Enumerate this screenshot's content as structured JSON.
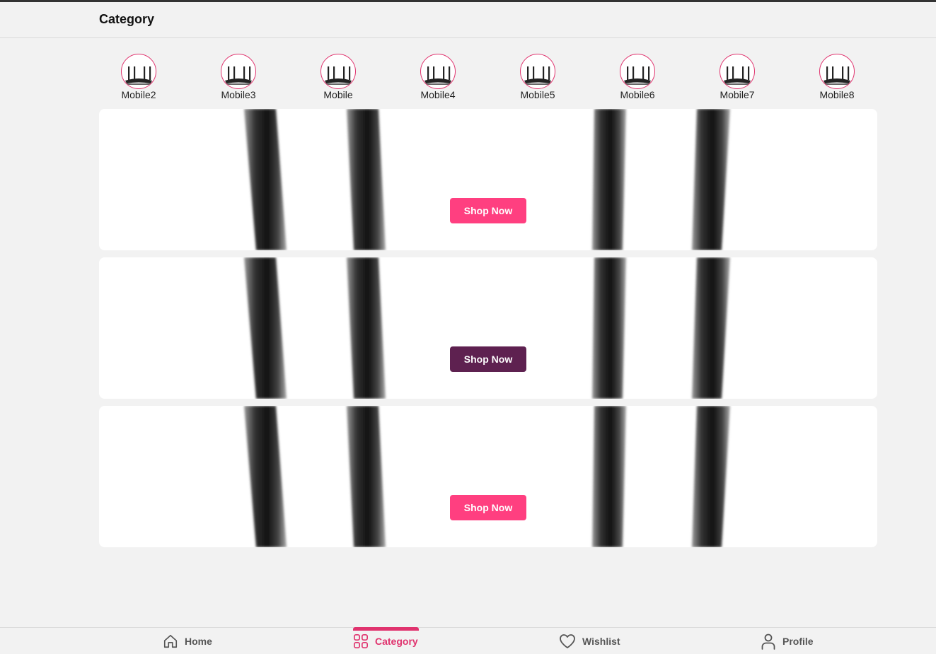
{
  "header": {
    "title": "Category"
  },
  "categories": [
    {
      "label": "Mobile2",
      "icon": "router-icon"
    },
    {
      "label": "Mobile3",
      "icon": "router-icon"
    },
    {
      "label": "Mobile",
      "icon": "router-icon"
    },
    {
      "label": "Mobile4",
      "icon": "router-icon"
    },
    {
      "label": "Mobile5",
      "icon": "router-icon"
    },
    {
      "label": "Mobile6",
      "icon": "router-icon"
    },
    {
      "label": "Mobile7",
      "icon": "router-icon"
    },
    {
      "label": "Mobile8",
      "icon": "router-icon"
    }
  ],
  "banners": [
    {
      "button_label": "Shop Now",
      "button_color": "#ff3f80"
    },
    {
      "button_label": "Shop Now",
      "button_color": "#5e2150"
    },
    {
      "button_label": "Shop Now",
      "button_color": "#ff3f80"
    }
  ],
  "bottom_nav": {
    "active_color": "#e0336e",
    "items": [
      {
        "label": "Home",
        "icon": "home-icon",
        "active": false
      },
      {
        "label": "Category",
        "icon": "category-grid-icon",
        "active": true
      },
      {
        "label": "Wishlist",
        "icon": "heart-icon",
        "active": false
      },
      {
        "label": "Profile",
        "icon": "user-icon",
        "active": false
      }
    ]
  }
}
